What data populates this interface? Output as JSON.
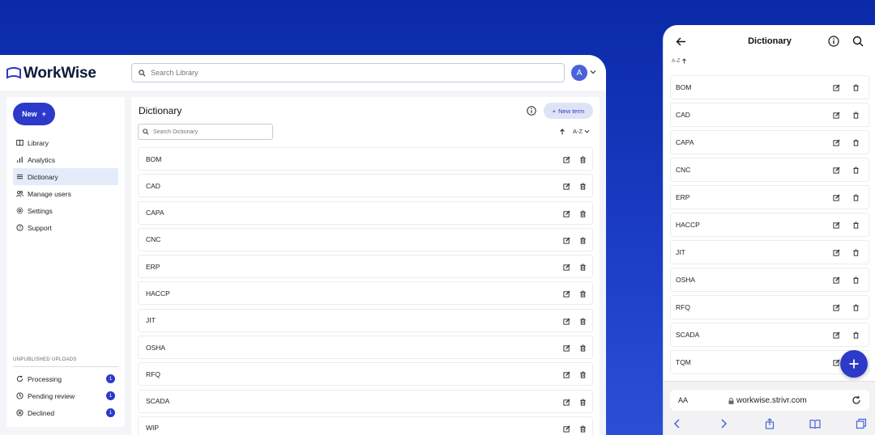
{
  "app": {
    "name": "WorkWise"
  },
  "topbar": {
    "search_placeholder": "Search Library",
    "avatar_initial": "A"
  },
  "sidebar": {
    "new_label": "New",
    "items": [
      {
        "label": "Library",
        "icon": "book-icon",
        "active": false
      },
      {
        "label": "Analytics",
        "icon": "bar-chart-icon",
        "active": false
      },
      {
        "label": "Dictionary",
        "icon": "list-icon",
        "active": true
      },
      {
        "label": "Manage users",
        "icon": "users-icon",
        "active": false
      },
      {
        "label": "Settings",
        "icon": "gear-icon",
        "active": false
      },
      {
        "label": "Support",
        "icon": "help-icon",
        "active": false
      }
    ],
    "uploads_title": "UNPUBLISHED UPLOADS",
    "uploads": [
      {
        "label": "Processing",
        "count": "1"
      },
      {
        "label": "Pending review",
        "count": "1"
      },
      {
        "label": "Declined",
        "count": "1"
      }
    ]
  },
  "main": {
    "title": "Dictionary",
    "new_term_label": "New term",
    "search_placeholder": "Search Dictionary",
    "sort_label": "A-Z",
    "terms": [
      "BOM",
      "CAD",
      "CAPA",
      "CNC",
      "ERP",
      "HACCP",
      "JIT",
      "OSHA",
      "RFQ",
      "SCADA",
      "WIP"
    ]
  },
  "mobile": {
    "title": "Dictionary",
    "sort_label": "A-Z",
    "terms": [
      "BOM",
      "CAD",
      "CAPA",
      "CNC",
      "ERP",
      "HACCP",
      "JIT",
      "OSHA",
      "RFQ",
      "SCADA",
      "TQM"
    ],
    "browser": {
      "aa": "AA",
      "url": "workwise.strivr.com"
    }
  },
  "colors": {
    "accent": "#2c39c9",
    "background": "#0a2aa8",
    "active_nav": "#e4ecfb"
  }
}
